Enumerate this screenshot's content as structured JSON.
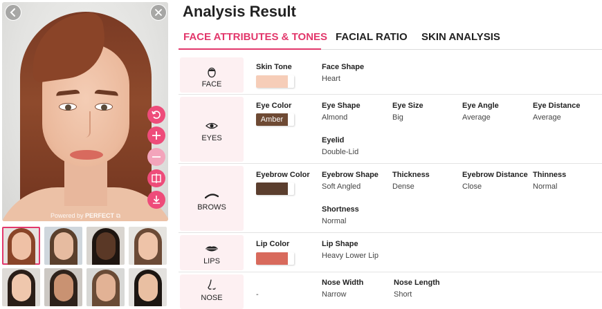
{
  "header": {
    "title": "Analysis Result"
  },
  "tabs": [
    {
      "label": "FACE ATTRIBUTES & TONES",
      "active": true
    },
    {
      "label": "FACIAL RATIO",
      "active": false
    },
    {
      "label": "SKIN ANALYSIS",
      "active": false
    }
  ],
  "photo": {
    "powered_by_prefix": "Powered by",
    "powered_by_brand": "PERFECT"
  },
  "colors": {
    "accent": "#e2376b",
    "category_bg": "#fdf0f2",
    "tool_button": "#ee4c7a"
  },
  "rows": {
    "face": {
      "category": "FACE",
      "color_label": "Skin Tone",
      "attrs": [
        {
          "label": "Face Shape",
          "value": "Heart"
        }
      ]
    },
    "eyes": {
      "category": "EYES",
      "color_label": "Eye Color",
      "swatch_text": "Amber",
      "attrs": [
        {
          "label": "Eye Shape",
          "value": "Almond"
        },
        {
          "label": "Eye Size",
          "value": "Big"
        },
        {
          "label": "Eye Angle",
          "value": "Average"
        },
        {
          "label": "Eye Distance",
          "value": "Average"
        },
        {
          "label": "Eyelid",
          "value": "Double-Lid"
        }
      ]
    },
    "brows": {
      "category": "BROWS",
      "color_label": "Eyebrow Color",
      "attrs": [
        {
          "label": "Eyebrow Shape",
          "value": "Soft Angled"
        },
        {
          "label": "Thickness",
          "value": "Dense"
        },
        {
          "label": "Eyebrow Distance",
          "value": "Close"
        },
        {
          "label": "Thinness",
          "value": "Normal"
        },
        {
          "label": "Shortness",
          "value": "Normal"
        }
      ]
    },
    "lips": {
      "category": "LIPS",
      "color_label": "Lip Color",
      "attrs": [
        {
          "label": "Lip Shape",
          "value": "Heavy Lower Lip"
        }
      ]
    },
    "nose": {
      "category": "NOSE",
      "color_value": "-",
      "attrs": [
        {
          "label": "Nose Width",
          "value": "Narrow"
        },
        {
          "label": "Nose Length",
          "value": "Short"
        }
      ]
    }
  },
  "swatch_colors": {
    "skin": "#f6cdb8",
    "eye": "#6e4a34",
    "eyebrow": "#5b3e2e",
    "lip": "#d86a5c"
  },
  "icons": {
    "back": "chevron-left-icon",
    "close": "close-icon",
    "tools": [
      "reset-icon",
      "zoom-in-icon",
      "zoom-out-icon",
      "compare-icon",
      "download-icon"
    ]
  }
}
